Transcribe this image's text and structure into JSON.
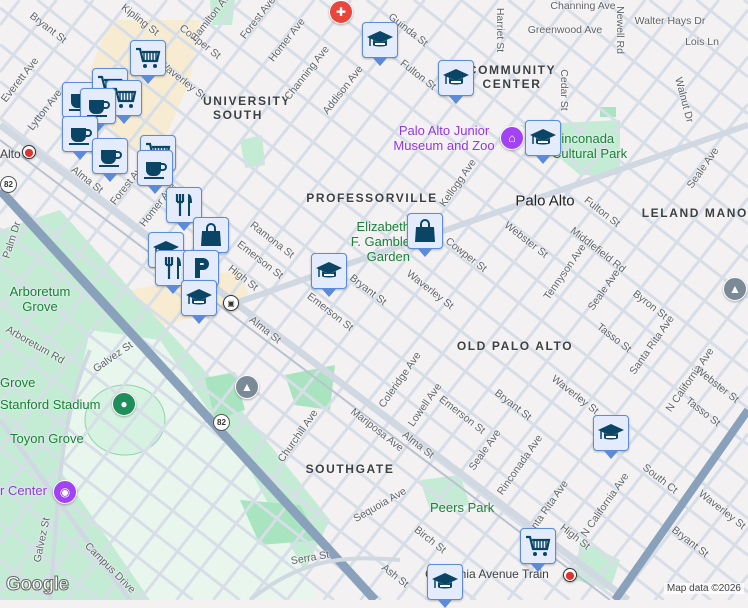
{
  "neighborhoods": [
    "UNIVERSITY SOUTH",
    "PROFESSORVILLE",
    "COMMUNITY CENTER",
    "LELAND MANOR",
    "OLD PALO ALTO",
    "SOUTHGATE"
  ],
  "city": "Palo Alto",
  "parks": [
    "Elizabeth F. Gamble Garden",
    "Rinconada Cultural Park",
    "Arboretum Grove",
    "Grove",
    "Stanford Stadium",
    "Toyon Grove",
    "Peers Park"
  ],
  "pois": [
    "Palo Alto Junior Museum and Zoo",
    "r Center"
  ],
  "transit": [
    "Alto",
    "California Avenue Train"
  ],
  "highway_shield": "82",
  "streets": [
    "Bryant St",
    "Kipling St",
    "Cowper St",
    "Hamilton Ave",
    "Forest Ave",
    "Homer Ave",
    "Channing Ave",
    "Addison Ave",
    "Waverley St",
    "Everett Ave",
    "Lytton Ave",
    "Alma St",
    "Forest Ave",
    "Homer Ave",
    "Ramona St",
    "Emerson St",
    "High St",
    "Palm Dr",
    "Arboretum Rd",
    "Galvez St",
    "Bryant St",
    "Emerson St",
    "Alma St",
    "Churchill Ave",
    "Mariposa Ave",
    "Sequoia Ave",
    "Serra St",
    "Galvez St",
    "Campus Drive",
    "Birch St",
    "Ash St",
    "Alma St",
    "Coleridge Ave",
    "Lowell Ave",
    "Emerson St",
    "Seale Ave",
    "Bryant St",
    "Rinconada Ave",
    "Santa Rita Ave",
    "High St",
    "N California Ave",
    "South Ct",
    "Waverley St",
    "Tasso St",
    "Santa Rita Ave",
    "N California Ave",
    "Webster St",
    "Tasso St",
    "Waverley St",
    "Bryant St",
    "Waverley St",
    "Cowper St",
    "Webster St",
    "Kellogg Ave",
    "Tennyson Ave",
    "Middlefield Rd",
    "Fulton St",
    "Seale Ave",
    "Byron St",
    "Seale Ave",
    "Walnut Dr",
    "Newell Rd",
    "Cedar St",
    "Harriet St",
    "Greenwood Ave",
    "Walter Hays Dr",
    "Lois Ln",
    "Channing Ave",
    "Guinda St",
    "Fulton St"
  ],
  "markers": [
    "cart",
    "cup",
    "cart",
    "cart",
    "cup",
    "cup",
    "cup",
    "cart",
    "cup",
    "fork",
    "bag",
    "grad",
    "fork",
    "parking",
    "grad",
    "grad",
    "grad",
    "grad",
    "bag",
    "grad",
    "grad",
    "cart",
    "grad"
  ],
  "attribution": "Map data ©2026",
  "logo": "Google",
  "colors": {
    "background": "#f3f1f2",
    "road": "#d7dee7",
    "park": "#c4ecd4",
    "highway": "#8aa1bb",
    "marker_fill": "#e4ecfc",
    "marker_border": "#5b8bd9",
    "icon": "#0b4566"
  }
}
